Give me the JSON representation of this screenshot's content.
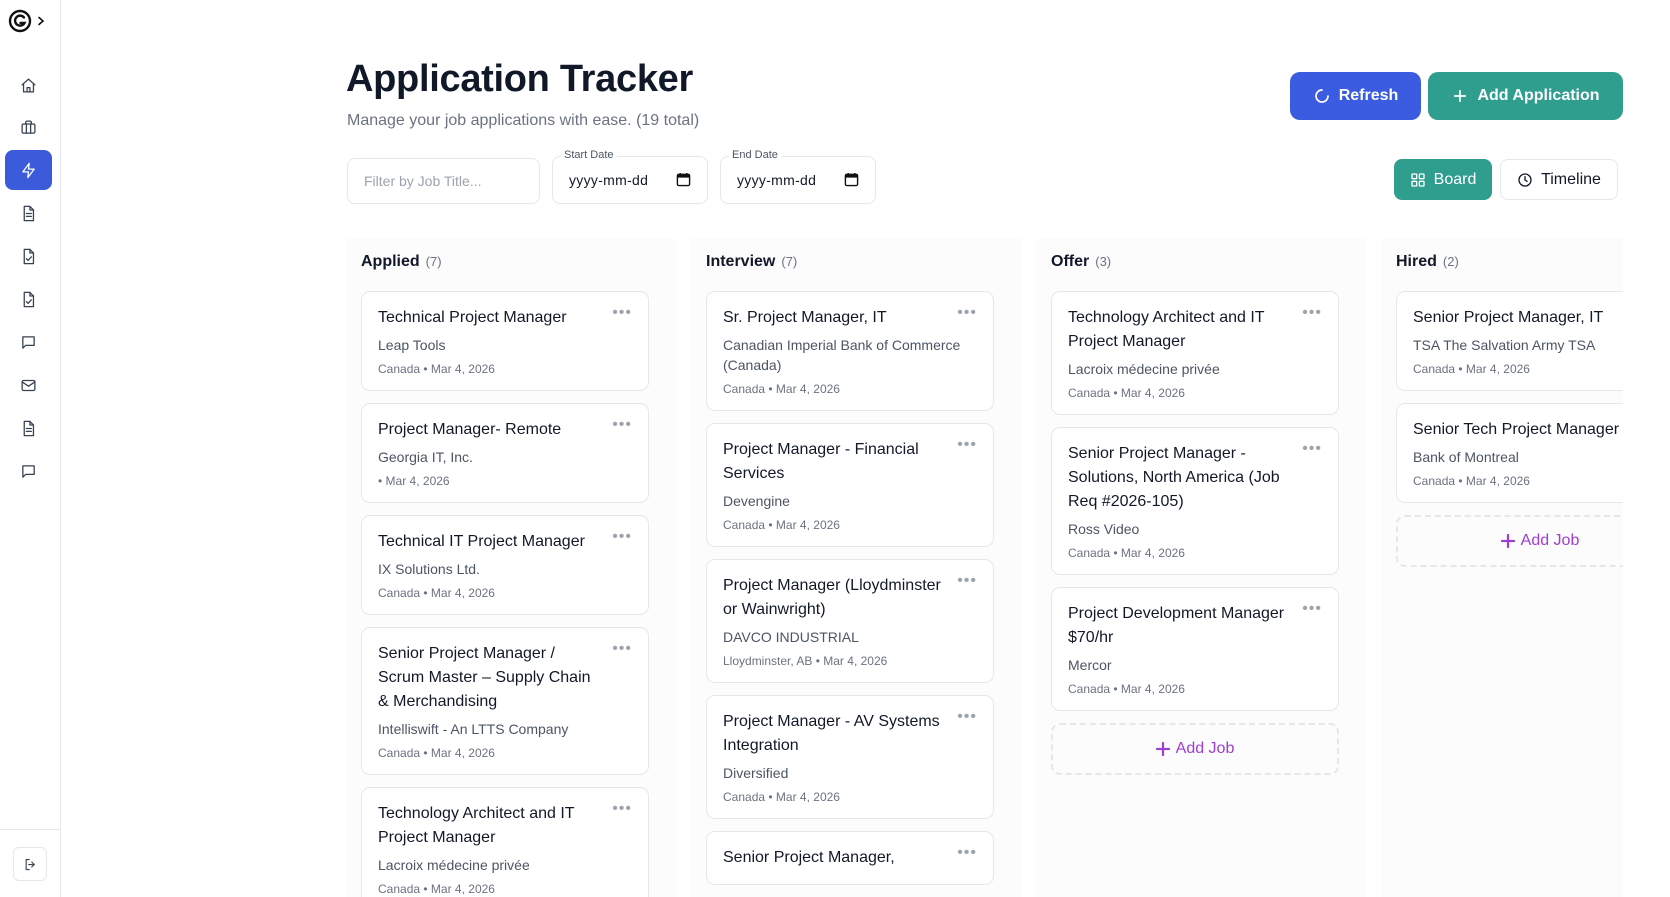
{
  "header": {
    "title": "Application Tracker",
    "subtitle": "Manage your job applications with ease. (19 total)",
    "refresh_label": "Refresh",
    "add_label": "Add Application"
  },
  "filters": {
    "job_title_placeholder": "Filter by Job Title...",
    "start_label": "Start Date",
    "start_value": "yyyy-mm-dd",
    "end_label": "End Date",
    "end_value": "yyyy-mm-dd"
  },
  "views": {
    "board": "Board",
    "timeline": "Timeline"
  },
  "sidebar": {
    "items": [
      "home-icon",
      "briefcase-icon",
      "lightning-icon",
      "document-icon",
      "file-check-icon",
      "file-check-icon",
      "chat-icon",
      "mail-icon",
      "document-icon",
      "chat-icon"
    ],
    "active_index": 2
  },
  "columns": [
    {
      "name": "Applied",
      "count": "(7)",
      "cards": [
        {
          "title": "Technical Project Manager",
          "company": "Leap Tools",
          "location": "Canada",
          "date": "Mar 4, 2026"
        },
        {
          "title": "Project Manager- Remote",
          "company": "Georgia IT, Inc.",
          "location": "",
          "date": "Mar 4, 2026"
        },
        {
          "title": "Technical IT Project Manager",
          "company": "IX Solutions Ltd.",
          "location": "Canada",
          "date": "Mar 4, 2026"
        },
        {
          "title": "Senior Project Manager / Scrum Master – Supply Chain & Merchandising",
          "company": "Intelliswift - An LTTS Company",
          "location": "Canada",
          "date": "Mar 4, 2026"
        },
        {
          "title": "Technology Architect and IT Project Manager",
          "company": "Lacroix médecine privée",
          "location": "Canada",
          "date": "Mar 4, 2026"
        }
      ]
    },
    {
      "name": "Interview",
      "count": "(7)",
      "cards": [
        {
          "title": "Sr. Project Manager, IT",
          "company": "Canadian Imperial Bank of Commerce (Canada)",
          "location": "Canada",
          "date": "Mar 4, 2026"
        },
        {
          "title": "Project Manager - Financial Services",
          "company": "Devengine",
          "location": "Canada",
          "date": "Mar 4, 2026"
        },
        {
          "title": "Project Manager (Lloydminster or Wainwright)",
          "company": "DAVCO INDUSTRIAL",
          "location": "Lloydminster, AB",
          "date": "Mar 4, 2026"
        },
        {
          "title": "Project Manager - AV Systems Integration",
          "company": "Diversified",
          "location": "Canada",
          "date": "Mar 4, 2026"
        },
        {
          "title": "Senior Project Manager,",
          "company": "",
          "location": "",
          "date": ""
        }
      ]
    },
    {
      "name": "Offer",
      "count": "(3)",
      "cards": [
        {
          "title": "Technology Architect and IT Project Manager",
          "company": "Lacroix médecine privée",
          "location": "Canada",
          "date": "Mar 4, 2026"
        },
        {
          "title": "Senior Project Manager - Solutions, North America (Job Req #2026-105)",
          "company": "Ross Video",
          "location": "Canada",
          "date": "Mar 4, 2026"
        },
        {
          "title": "Project Development Manager $70/hr",
          "company": "Mercor",
          "location": "Canada",
          "date": "Mar 4, 2026"
        }
      ],
      "add_job": "Add Job"
    },
    {
      "name": "Hired",
      "count": "(2)",
      "cards": [
        {
          "title": "Senior Project Manager, IT",
          "company": "TSA The Salvation Army TSA",
          "location": "Canada",
          "date": "Mar 4, 2026"
        },
        {
          "title": "Senior Tech Project Manager",
          "company": "Bank of Montreal",
          "location": "Canada",
          "date": "Mar 4, 2026"
        }
      ],
      "add_job": "Add Job"
    }
  ]
}
